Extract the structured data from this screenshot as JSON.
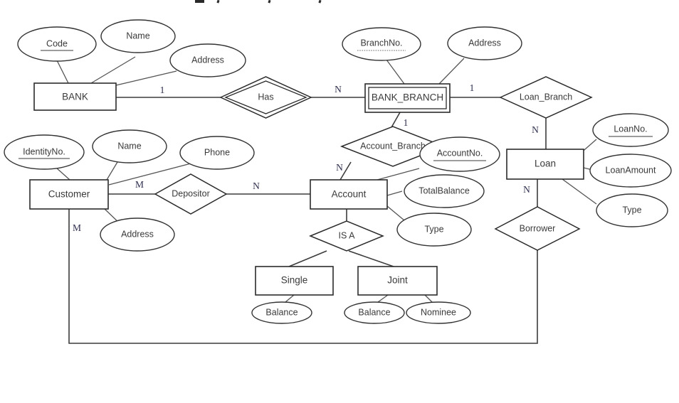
{
  "diagram": {
    "title": "Bank ER Diagram",
    "type": "entity-relationship-diagram",
    "notation": "Chen",
    "entities": [
      {
        "id": "bank",
        "label": "BANK",
        "kind": "strong"
      },
      {
        "id": "bank_branch",
        "label": "BANK_BRANCH",
        "kind": "weak"
      },
      {
        "id": "customer",
        "label": "Customer",
        "kind": "strong"
      },
      {
        "id": "account",
        "label": "Account",
        "kind": "strong"
      },
      {
        "id": "loan",
        "label": "Loan",
        "kind": "strong"
      },
      {
        "id": "single",
        "label": "Single",
        "kind": "subclass"
      },
      {
        "id": "joint",
        "label": "Joint",
        "kind": "subclass"
      }
    ],
    "relationships": [
      {
        "id": "has",
        "label": "Has",
        "kind": "identifying",
        "from": "BANK",
        "to": "BANK_BRANCH",
        "from_card": "1",
        "to_card": "N"
      },
      {
        "id": "loan_branch",
        "label": "Loan_Branch",
        "kind": "normal",
        "from": "BANK_BRANCH",
        "to": "Loan",
        "from_card": "1",
        "to_card": "N"
      },
      {
        "id": "account_branch",
        "label": "Account_Branch",
        "kind": "normal",
        "from": "BANK_BRANCH",
        "to": "Account",
        "from_card": "1",
        "to_card": "N"
      },
      {
        "id": "depositor",
        "label": "Depositor",
        "kind": "normal",
        "from": "Customer",
        "to": "Account",
        "from_card": "M",
        "to_card": "N"
      },
      {
        "id": "borrower",
        "label": "Borrower",
        "kind": "normal",
        "from": "Loan",
        "to": "Customer",
        "from_card": "N",
        "to_card": "M"
      },
      {
        "id": "is_a",
        "label": "IS A",
        "kind": "specialization",
        "from": "Account",
        "to": "Single, Joint",
        "from_card": "",
        "to_card": ""
      }
    ],
    "attributes": [
      {
        "id": "bank_code",
        "label": "Code",
        "owner": "BANK",
        "key": "primary"
      },
      {
        "id": "bank_name",
        "label": "Name",
        "owner": "BANK",
        "key": "none"
      },
      {
        "id": "bank_address",
        "label": "Address",
        "owner": "BANK",
        "key": "none"
      },
      {
        "id": "branch_no",
        "label": "BranchNo.",
        "owner": "BANK_BRANCH",
        "key": "partial"
      },
      {
        "id": "branch_address",
        "label": "Address",
        "owner": "BANK_BRANCH",
        "key": "none"
      },
      {
        "id": "cust_identityno",
        "label": "IdentityNo.",
        "owner": "Customer",
        "key": "primary"
      },
      {
        "id": "cust_name",
        "label": "Name",
        "owner": "Customer",
        "key": "none"
      },
      {
        "id": "cust_phone",
        "label": "Phone",
        "owner": "Customer",
        "key": "none"
      },
      {
        "id": "cust_address",
        "label": "Address",
        "owner": "Customer",
        "key": "none"
      },
      {
        "id": "acct_no",
        "label": "AccountNo.",
        "owner": "Account",
        "key": "primary"
      },
      {
        "id": "acct_totalbal",
        "label": "TotalBalance",
        "owner": "Account",
        "key": "none"
      },
      {
        "id": "acct_type",
        "label": "Type",
        "owner": "Account",
        "key": "none"
      },
      {
        "id": "loan_no",
        "label": "LoanNo.",
        "owner": "Loan",
        "key": "primary"
      },
      {
        "id": "loan_amount",
        "label": "LoanAmount",
        "owner": "Loan",
        "key": "none"
      },
      {
        "id": "loan_type",
        "label": "Type",
        "owner": "Loan",
        "key": "none"
      },
      {
        "id": "single_balance",
        "label": "Balance",
        "owner": "Single",
        "key": "none"
      },
      {
        "id": "joint_balance",
        "label": "Balance",
        "owner": "Joint",
        "key": "none"
      },
      {
        "id": "joint_nominee",
        "label": "Nominee",
        "owner": "Joint",
        "key": "none"
      }
    ],
    "cardinality_markers": [
      {
        "id": "card_bank_has",
        "text": "1"
      },
      {
        "id": "card_has_branch",
        "text": "N"
      },
      {
        "id": "card_branch_loanbranch",
        "text": "1"
      },
      {
        "id": "card_loanbranch_loan",
        "text": "N"
      },
      {
        "id": "card_branch_acctbranch",
        "text": "1"
      },
      {
        "id": "card_acctbranch_account",
        "text": "N"
      },
      {
        "id": "card_customer_depositor",
        "text": "M"
      },
      {
        "id": "card_depositor_account",
        "text": "N"
      },
      {
        "id": "card_loan_borrower",
        "text": "N"
      },
      {
        "id": "card_borrower_customer",
        "text": "M"
      }
    ],
    "colors": {
      "background": "#ffffff",
      "stroke": "#2b2b2b",
      "text": "#3a3a3a",
      "cardinality_text": "#2f2f4f"
    }
  }
}
